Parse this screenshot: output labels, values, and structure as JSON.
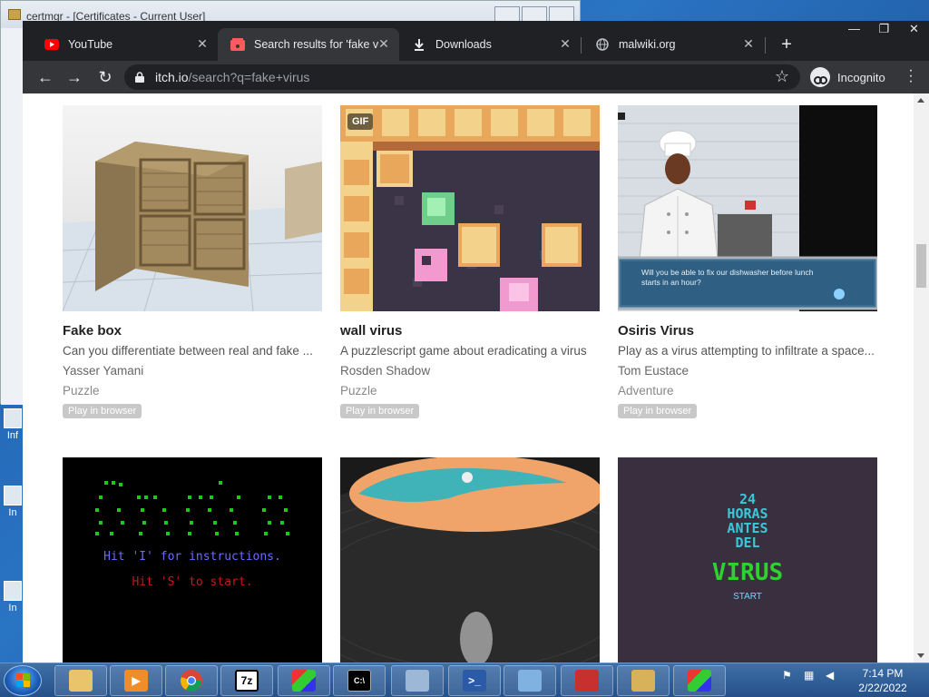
{
  "background_window": {
    "title": "certmgr - [Certificates - Current User]"
  },
  "desktop_icons": [
    "Inf",
    "In",
    "In"
  ],
  "browser": {
    "tabs": [
      {
        "label": "YouTube",
        "icon": "youtube-icon"
      },
      {
        "label": "Search results for 'fake vir",
        "icon": "itchio-icon",
        "active": true
      },
      {
        "label": "Downloads",
        "icon": "download-icon"
      },
      {
        "label": "malwiki.org",
        "icon": "globe-icon"
      }
    ],
    "url_domain": "itch.io",
    "url_path": "/search?q=fake+virus",
    "profile_label": "Incognito"
  },
  "games": [
    {
      "title": "Fake box",
      "desc": "Can you differentiate between real and fake ...",
      "author": "Yasser Yamani",
      "genre": "Puzzle",
      "tag": "Play in browser"
    },
    {
      "title": "wall virus",
      "desc": "A puzzlescript game about eradicating a virus",
      "author": "Rosden Shadow",
      "genre": "Puzzle",
      "tag": "Play in browser",
      "badge": "GIF"
    },
    {
      "title": "Osiris Virus",
      "desc": "Play as a virus attempting to infiltrate a space...",
      "author": "Tom Eustace",
      "genre": "Adventure",
      "tag": "Play in browser"
    }
  ],
  "thumb_text": {
    "osiris_dialog": "Will you be able to fix our dishwasher before lunch starts in an hour?",
    "retro_line1": "Hit 'I' for instructions.",
    "retro_line2": "Hit 'S' to start.",
    "horas_1": "24",
    "horas_2": "HORAS",
    "horas_3": "ANTES",
    "horas_4": "DEL",
    "horas_5": "VIRUS",
    "horas_start": "START"
  },
  "taskbar": {
    "time": "7:14 PM",
    "date": "2/22/2022"
  }
}
